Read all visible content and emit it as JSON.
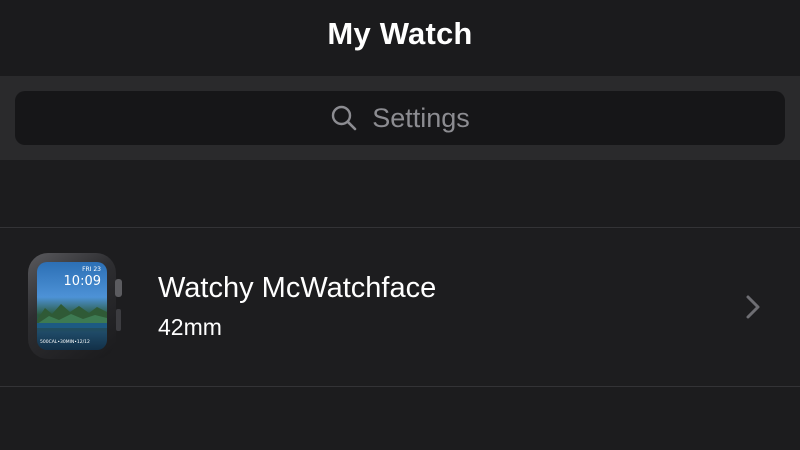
{
  "navbar": {
    "title": "My Watch"
  },
  "search": {
    "placeholder": "Settings",
    "icon": "search-icon"
  },
  "device": {
    "name": "Watchy McWatchface",
    "size": "42mm",
    "thumbnail": {
      "date": "FRI 23",
      "time": "10:09",
      "complications": "500CAL•30MIN•12/12"
    },
    "chevron_icon": "chevron-right-icon"
  },
  "colors": {
    "background": "#1c1c1e",
    "search_band": "#2a2a2c",
    "search_field": "#161618",
    "secondary_text": "#8c8c91"
  }
}
